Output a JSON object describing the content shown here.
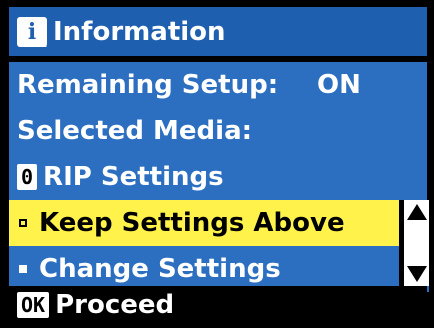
{
  "title": "Information",
  "rows": {
    "remaining_setup_label": "Remaining Setup:",
    "remaining_setup_value": "ON",
    "selected_media_label": "Selected Media:",
    "rip_key": "0",
    "rip_label": "RIP Settings"
  },
  "menu": {
    "options": [
      "Keep Settings Above",
      "Change Settings"
    ],
    "selected_index": 0
  },
  "footer": {
    "ok_key": "OK",
    "proceed_label": "Proceed"
  },
  "icons": [
    "info-icon",
    "scroll-up-arrow-icon",
    "scroll-down-arrow-icon"
  ],
  "colors": {
    "title_bg": "#1f5fb0",
    "row_bg": "#2c6fc0",
    "selected_bg": "#fff24a",
    "background": "#000000",
    "text": "#ffffff"
  }
}
